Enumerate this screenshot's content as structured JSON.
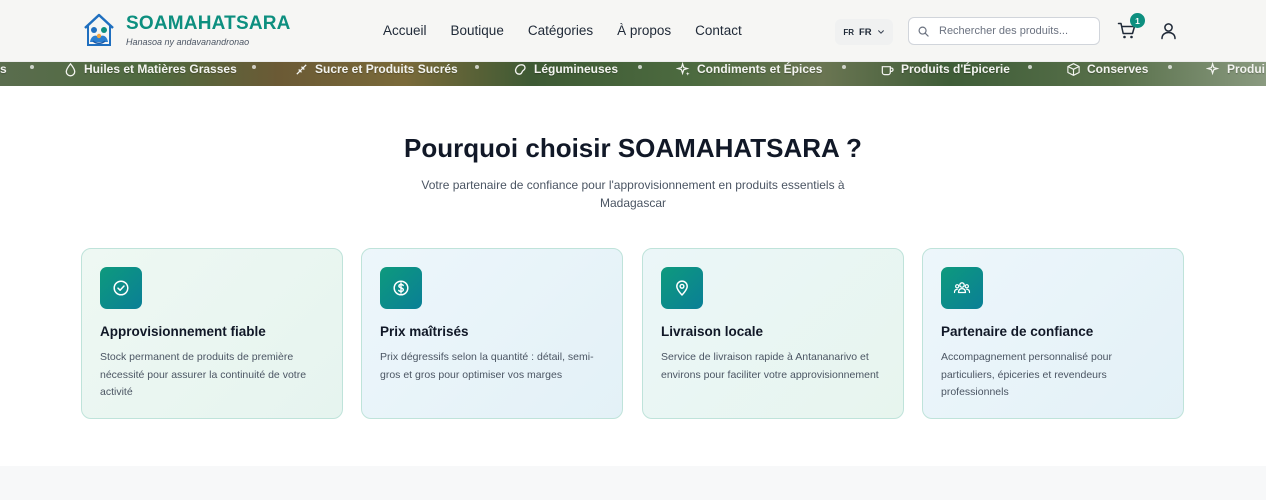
{
  "header": {
    "brand_name": "SOAMAHATSARA",
    "brand_tagline": "Hanasoa ny andavanandronao",
    "logo_icon": "house-family-logo",
    "nav": [
      "Accueil",
      "Boutique",
      "Catégories",
      "À propos",
      "Contact"
    ],
    "lang_flag": "FR",
    "lang_code": "FR",
    "search_placeholder": "Rechercher des produits...",
    "cart_count": "1"
  },
  "category_strip": {
    "items": [
      {
        "label": "s",
        "icon": ""
      },
      {
        "label": "Huiles et Matières Grasses",
        "icon": "drop-icon"
      },
      {
        "label": "Sucre et Produits Sucrés",
        "icon": "candy-icon"
      },
      {
        "label": "Légumineuses",
        "icon": "bean-icon"
      },
      {
        "label": "Condiments et Épices",
        "icon": "sparkles-icon"
      },
      {
        "label": "Produits d'Épicerie",
        "icon": "cup-icon"
      },
      {
        "label": "Conserves",
        "icon": "box-icon"
      },
      {
        "label": "Produi",
        "icon": "sparkles-icon"
      }
    ]
  },
  "section": {
    "title": "Pourquoi choisir SOAMAHATSARA ?",
    "subtitle": "Votre partenaire de confiance pour l'approvisionnement en produits essentiels à Madagascar"
  },
  "cards": [
    {
      "title": "Approvisionnement fiable",
      "desc": "Stock permanent de produits de première nécessité pour assurer la continuité de votre activité",
      "icon": "check-circle-icon"
    },
    {
      "title": "Prix maîtrisés",
      "desc": "Prix dégressifs selon la quantité : détail, semi-gros et gros pour optimiser vos marges",
      "icon": "dollar-circle-icon"
    },
    {
      "title": "Livraison locale",
      "desc": "Service de livraison rapide à Antananarivo et environs pour faciliter votre approvisionnement",
      "icon": "map-pin-icon"
    },
    {
      "title": "Partenaire de confiance",
      "desc": "Accompagnement personnalisé pour particuliers, épiceries et revendeurs professionnels",
      "icon": "users-icon"
    }
  ],
  "colors": {
    "brand": "#0d8f7f",
    "icon_gradient_start": "#0e9a7d",
    "icon_gradient_end": "#0a7f96"
  }
}
